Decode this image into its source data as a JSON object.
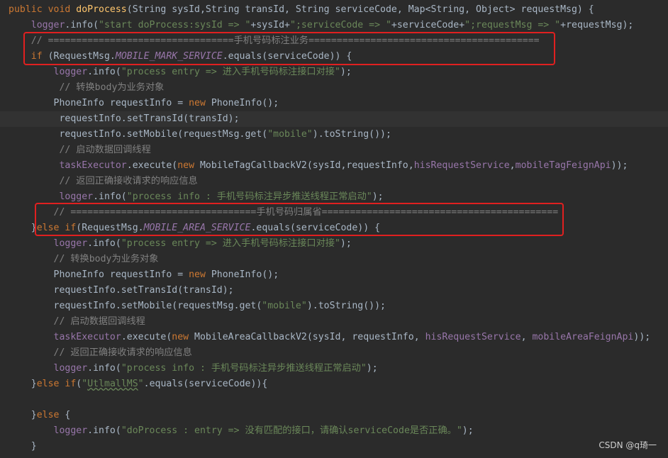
{
  "editor": {
    "lines": [
      {
        "indent": "",
        "segments": [
          {
            "t": "public ",
            "c": "kw"
          },
          {
            "t": "void ",
            "c": "kw"
          },
          {
            "t": "doProcess",
            "c": "method"
          },
          {
            "t": "(String sysId,String transId, String serviceCode, Map<String, Object> requestMsg) {",
            "c": ""
          }
        ]
      },
      {
        "indent": "    ",
        "segments": [
          {
            "t": "logger",
            "c": "fld"
          },
          {
            "t": ".info(",
            "c": ""
          },
          {
            "t": "\"start doProcess:sysId => \"",
            "c": "str"
          },
          {
            "t": "+sysId+",
            "c": ""
          },
          {
            "t": "\";serviceCode => \"",
            "c": "str"
          },
          {
            "t": "+serviceCode+",
            "c": ""
          },
          {
            "t": "\";requestMsg => \"",
            "c": "str"
          },
          {
            "t": "+requestMsg);",
            "c": ""
          }
        ]
      },
      {
        "indent": "    ",
        "segments": [
          {
            "t": "// =================================手机号码标注业务=========================================",
            "c": "cm"
          }
        ]
      },
      {
        "indent": "    ",
        "segments": [
          {
            "t": "if ",
            "c": "kw"
          },
          {
            "t": "(RequestMsg.",
            "c": ""
          },
          {
            "t": "MOBILE_MARK_SERVICE",
            "c": "fld ital"
          },
          {
            "t": ".equals(serviceCode)) {",
            "c": ""
          }
        ]
      },
      {
        "indent": "        ",
        "segments": [
          {
            "t": "logger",
            "c": "fld"
          },
          {
            "t": ".info(",
            "c": ""
          },
          {
            "t": "\"process entry => 进入手机号码标注接口对接\"",
            "c": "str"
          },
          {
            "t": ");",
            "c": ""
          }
        ]
      },
      {
        "indent": "         ",
        "segments": [
          {
            "t": "// 转换body为业务对象",
            "c": "cm"
          }
        ]
      },
      {
        "indent": "        ",
        "segments": [
          {
            "t": "PhoneInfo requestInfo = ",
            "c": ""
          },
          {
            "t": "new ",
            "c": "kw"
          },
          {
            "t": "PhoneInfo();",
            "c": ""
          }
        ]
      },
      {
        "indent": "         ",
        "segments": [
          {
            "t": "requestInfo.setTransId(transId);",
            "c": ""
          }
        ]
      },
      {
        "indent": "         ",
        "segments": [
          {
            "t": "requestInfo.setMobile(requestMsg.get(",
            "c": ""
          },
          {
            "t": "\"mobile\"",
            "c": "str"
          },
          {
            "t": ").toString());",
            "c": ""
          }
        ]
      },
      {
        "indent": "         ",
        "segments": [
          {
            "t": "// 启动数据回调线程",
            "c": "cm"
          }
        ]
      },
      {
        "indent": "         ",
        "segments": [
          {
            "t": "taskExecutor",
            "c": "fld"
          },
          {
            "t": ".execute(",
            "c": ""
          },
          {
            "t": "new ",
            "c": "kw"
          },
          {
            "t": "MobileTagCallbackV2(sysId,requestInfo,",
            "c": ""
          },
          {
            "t": "hisRequestService",
            "c": "fld"
          },
          {
            "t": ",",
            "c": ""
          },
          {
            "t": "mobileTagFeignApi",
            "c": "fld"
          },
          {
            "t": "));",
            "c": ""
          }
        ]
      },
      {
        "indent": "         ",
        "segments": [
          {
            "t": "// 返回正确接收请求的响应信息",
            "c": "cm"
          }
        ]
      },
      {
        "indent": "         ",
        "segments": [
          {
            "t": "logger",
            "c": "fld"
          },
          {
            "t": ".info(",
            "c": ""
          },
          {
            "t": "\"process info : 手机号码标注异步推送线程正常启动\"",
            "c": "str"
          },
          {
            "t": ");",
            "c": ""
          }
        ]
      },
      {
        "indent": "        ",
        "segments": [
          {
            "t": "// =================================手机号码归属省==========================================",
            "c": "cm"
          }
        ]
      },
      {
        "indent": "    ",
        "segments": [
          {
            "t": "}",
            "c": ""
          },
          {
            "t": "else if",
            "c": "kw"
          },
          {
            "t": "(RequestMsg.",
            "c": ""
          },
          {
            "t": "MOBILE_AREA_SERVICE",
            "c": "fld ital"
          },
          {
            "t": ".equals(serviceCode)) {",
            "c": ""
          }
        ]
      },
      {
        "indent": "        ",
        "segments": [
          {
            "t": "logger",
            "c": "fld"
          },
          {
            "t": ".info(",
            "c": ""
          },
          {
            "t": "\"process entry => 进入手机号码标注接口对接\"",
            "c": "str"
          },
          {
            "t": ");",
            "c": ""
          }
        ]
      },
      {
        "indent": "        ",
        "segments": [
          {
            "t": "// 转换body为业务对象",
            "c": "cm"
          }
        ]
      },
      {
        "indent": "        ",
        "segments": [
          {
            "t": "PhoneInfo requestInfo = ",
            "c": ""
          },
          {
            "t": "new ",
            "c": "kw"
          },
          {
            "t": "PhoneInfo();",
            "c": ""
          }
        ]
      },
      {
        "indent": "        ",
        "segments": [
          {
            "t": "requestInfo.setTransId(transId);",
            "c": ""
          }
        ]
      },
      {
        "indent": "        ",
        "segments": [
          {
            "t": "requestInfo.setMobile(requestMsg.get(",
            "c": ""
          },
          {
            "t": "\"mobile\"",
            "c": "str"
          },
          {
            "t": ").toString());",
            "c": ""
          }
        ]
      },
      {
        "indent": "        ",
        "segments": [
          {
            "t": "// 启动数据回调线程",
            "c": "cm"
          }
        ]
      },
      {
        "indent": "        ",
        "segments": [
          {
            "t": "taskExecutor",
            "c": "fld"
          },
          {
            "t": ".execute(",
            "c": ""
          },
          {
            "t": "new ",
            "c": "kw"
          },
          {
            "t": "MobileAreaCallbackV2(sysId, requestInfo, ",
            "c": ""
          },
          {
            "t": "hisRequestService",
            "c": "fld"
          },
          {
            "t": ", ",
            "c": ""
          },
          {
            "t": "mobileAreaFeignApi",
            "c": "fld"
          },
          {
            "t": "));",
            "c": ""
          }
        ]
      },
      {
        "indent": "        ",
        "segments": [
          {
            "t": "// 返回正确接收请求的响应信息",
            "c": "cm"
          }
        ]
      },
      {
        "indent": "        ",
        "segments": [
          {
            "t": "logger",
            "c": "fld"
          },
          {
            "t": ".info(",
            "c": ""
          },
          {
            "t": "\"process info : 手机号码标注异步推送线程正常启动\"",
            "c": "str"
          },
          {
            "t": ");",
            "c": ""
          }
        ]
      },
      {
        "indent": "    ",
        "segments": [
          {
            "t": "}",
            "c": ""
          },
          {
            "t": "else if",
            "c": "kw"
          },
          {
            "t": "(",
            "c": ""
          },
          {
            "t": "\"",
            "c": "str"
          },
          {
            "t": "UtlmallMS",
            "c": "str wavy"
          },
          {
            "t": "\"",
            "c": "str"
          },
          {
            "t": ".equals(serviceCode)){",
            "c": ""
          }
        ]
      },
      {
        "indent": "",
        "segments": []
      },
      {
        "indent": "    ",
        "segments": [
          {
            "t": "}",
            "c": ""
          },
          {
            "t": "else ",
            "c": "kw"
          },
          {
            "t": "{",
            "c": ""
          }
        ]
      },
      {
        "indent": "        ",
        "segments": [
          {
            "t": "logger",
            "c": "fld"
          },
          {
            "t": ".info(",
            "c": ""
          },
          {
            "t": "\"doProcess : entry => 没有匹配的接口，请确认serviceCode是否正确。\"",
            "c": "str"
          },
          {
            "t": ");",
            "c": ""
          }
        ]
      },
      {
        "indent": "    ",
        "segments": [
          {
            "t": "}",
            "c": ""
          }
        ]
      }
    ]
  },
  "watermark": "CSDN @q琦一",
  "colors": {
    "background": "#2b2b2b",
    "keyword": "#cc7832",
    "string": "#6a8759",
    "comment": "#808080",
    "field": "#9876aa",
    "method": "#ffc66d",
    "default": "#a9b7c6",
    "highlight_box": "#e02020"
  }
}
